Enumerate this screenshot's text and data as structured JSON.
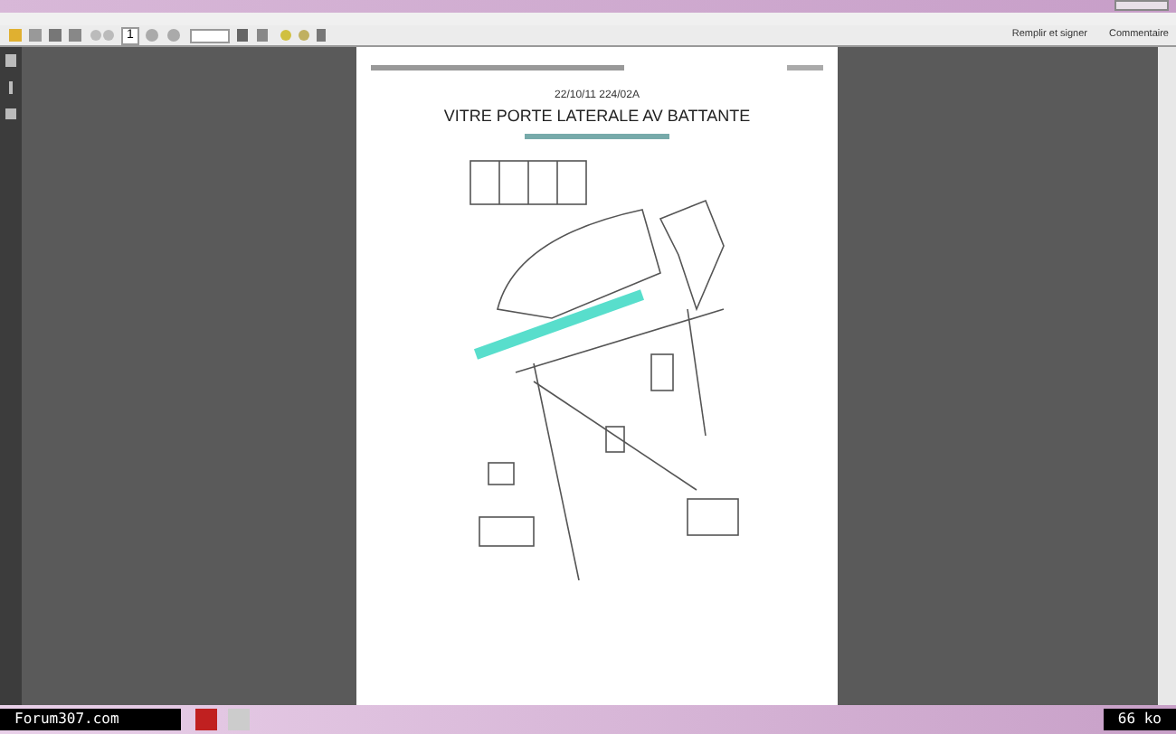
{
  "toolbar": {
    "page_number": "1",
    "panes": [
      {
        "label": "Remplir et signer"
      },
      {
        "label": "Commentaire"
      }
    ]
  },
  "document": {
    "code": "22/10/11 224/02A",
    "title": "VITRE PORTE LATERALE AV BATTANTE"
  },
  "status_bar": {
    "site": "Forum307.com",
    "size": "66 ko"
  }
}
